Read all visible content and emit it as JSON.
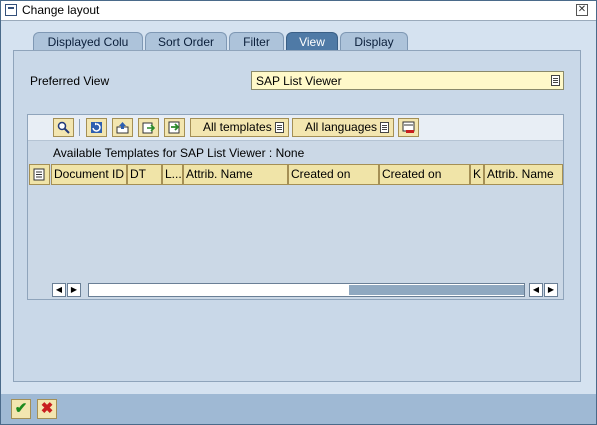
{
  "window": {
    "title": "Change layout"
  },
  "tabs": [
    {
      "label": "Displayed Colu"
    },
    {
      "label": "Sort Order"
    },
    {
      "label": "Filter"
    },
    {
      "label": "View"
    },
    {
      "label": "Display"
    }
  ],
  "active_tab": "View",
  "preferred_view": {
    "label": "Preferred View",
    "value": "SAP List Viewer"
  },
  "toolbar": {
    "all_templates": "All templates",
    "all_languages": "All languages",
    "icons": [
      "details-icon",
      "refresh-icon",
      "upload-icon",
      "download-icon",
      "export-icon",
      "delete-icon"
    ]
  },
  "templates_info": "Available Templates for SAP List Viewer : None",
  "columns": [
    "Document ID",
    "DT",
    "L...",
    "Attrib. Name",
    "Created on",
    "Created on",
    "K",
    "Attrib. Name"
  ],
  "colors": {
    "tab_active": "#4f7aa6",
    "field_bg": "#fff9c9",
    "button_bg": "#f3e6b0"
  },
  "footer": {
    "ok_icon": "checkmark-icon",
    "cancel_icon": "cancel-x-icon"
  }
}
